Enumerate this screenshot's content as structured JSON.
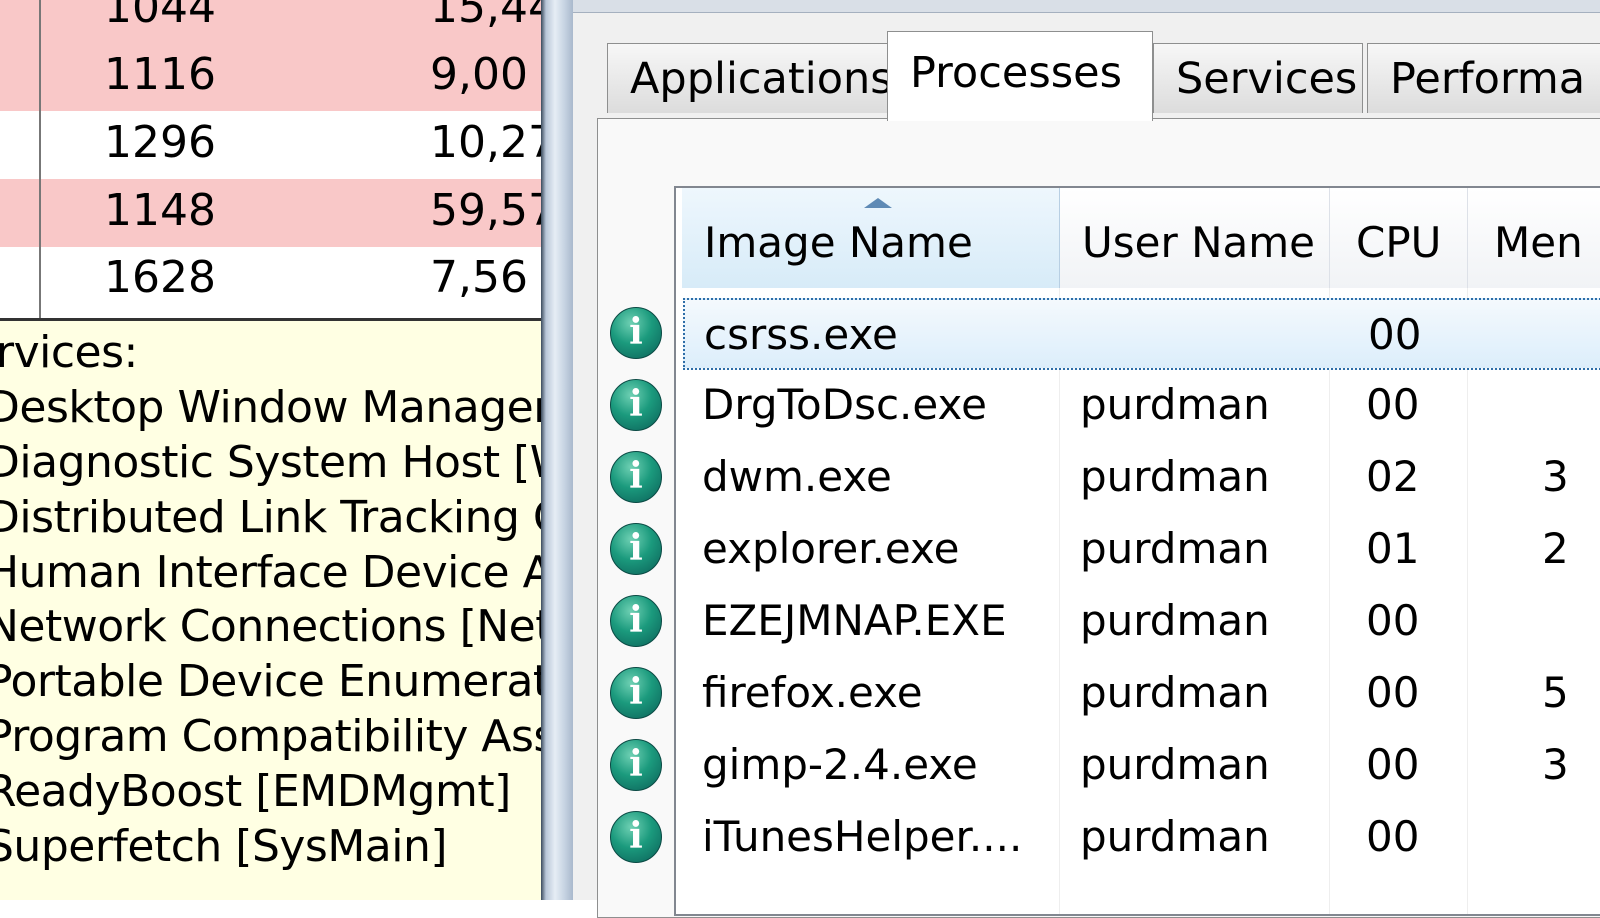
{
  "background_window": {
    "process_rows": [
      {
        "pid": "1044",
        "mem": "15,44",
        "highlight": true
      },
      {
        "pid": "1116",
        "mem": "9,00",
        "highlight": true
      },
      {
        "pid": "1296",
        "mem": "10,27",
        "highlight": false
      },
      {
        "pid": "1148",
        "mem": "59,57",
        "highlight": true
      },
      {
        "pid": "1628",
        "mem": "7,56",
        "highlight": false
      }
    ],
    "tooltip": {
      "heading": "rvices:",
      "lines": [
        "Desktop Window Manager S",
        "Diagnostic System Host [Wd",
        "Distributed Link Tracking Cli",
        "Human Interface Device Ac",
        "Network Connections [Netm",
        "Portable Device Enumerator",
        "Program Compatibility Assista",
        "ReadyBoost [EMDMgmt]",
        "Superfetch [SysMain]"
      ]
    }
  },
  "task_manager": {
    "tabs": [
      {
        "label": "Applications",
        "active": false
      },
      {
        "label": "Processes",
        "active": true
      },
      {
        "label": "Services",
        "active": false
      },
      {
        "label": "Performa",
        "active": false
      }
    ],
    "columns": {
      "image_name": "Image Name",
      "user_name": "User Name",
      "cpu": "CPU",
      "memory": "Men"
    },
    "icon": "info-icon",
    "processes": [
      {
        "name": "csrss.exe",
        "user": "",
        "cpu": "00",
        "mem": "",
        "selected": true
      },
      {
        "name": "DrgToDsc.exe",
        "user": "purdman",
        "cpu": "00",
        "mem": ""
      },
      {
        "name": "dwm.exe",
        "user": "purdman",
        "cpu": "02",
        "mem": "3"
      },
      {
        "name": "explorer.exe",
        "user": "purdman",
        "cpu": "01",
        "mem": "2"
      },
      {
        "name": "EZEJMNAP.EXE",
        "user": "purdman",
        "cpu": "00",
        "mem": ""
      },
      {
        "name": "firefox.exe",
        "user": "purdman",
        "cpu": "00",
        "mem": "5"
      },
      {
        "name": "gimp-2.4.exe",
        "user": "purdman",
        "cpu": "00",
        "mem": "3"
      },
      {
        "name": "iTunesHelper....",
        "user": "purdman",
        "cpu": "00",
        "mem": ""
      }
    ]
  }
}
